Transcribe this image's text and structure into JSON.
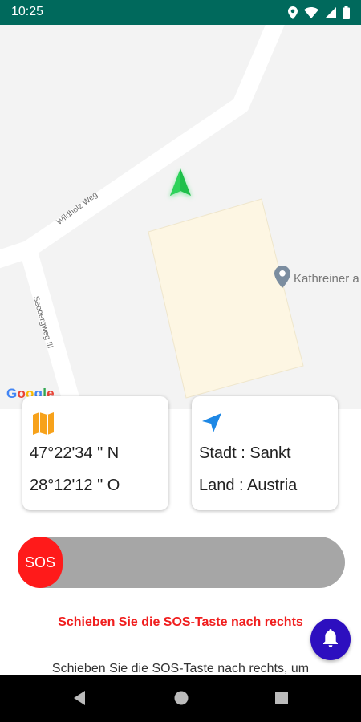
{
  "status_bar": {
    "time": "10:25",
    "icons": [
      "location-icon",
      "wifi-icon",
      "signal-icon",
      "battery-icon"
    ]
  },
  "map": {
    "streets": [
      "Wildholz Weg",
      "Seebergweg III"
    ],
    "poi_label": "Kathreiner a",
    "attribution": "Google",
    "colors": {
      "background": "#f3f3f3",
      "road": "#ffffff",
      "building": "#fdf6e3",
      "nav_arrow": "#1fbf4a",
      "poi_pin": "#7b8da0"
    }
  },
  "cards": {
    "coordinates": {
      "icon": "map-icon",
      "latitude": "47°22'34 \" N",
      "longitude": "28°12'12 \" O"
    },
    "location": {
      "icon": "navigation-arrow-icon",
      "city": "Stadt : Sankt",
      "country": "Land : Austria"
    }
  },
  "sos": {
    "label": "SOS",
    "progress": 0,
    "colors": {
      "knob": "#ff1a1a",
      "track": "#a6a6a6"
    }
  },
  "instruction_title": "Schieben Sie die SOS-Taste nach rechts",
  "instruction_text": "Schieben Sie die SOS-Taste nach rechts, um",
  "fab": {
    "icon": "bell-icon",
    "color": "#2d0fbf"
  },
  "nav_bar": {
    "buttons": [
      "back-icon",
      "home-icon",
      "recents-icon"
    ]
  }
}
